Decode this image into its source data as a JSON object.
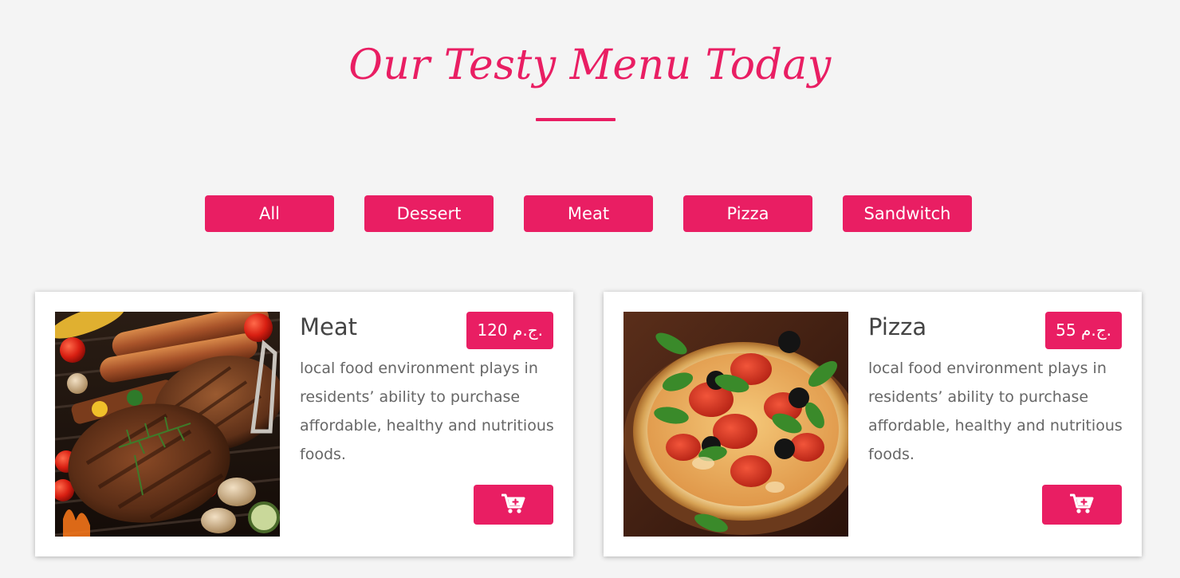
{
  "page": {
    "title": "Our Testy Menu Today"
  },
  "filters": [
    {
      "label": "All"
    },
    {
      "label": "Dessert"
    },
    {
      "label": "Meat"
    },
    {
      "label": "Pizza"
    },
    {
      "label": "Sandwitch"
    }
  ],
  "cards": [
    {
      "name": "Meat",
      "price": "120 ج.م.",
      "description": "local food environment plays in residents’ ability to purchase affordable, healthy and nutritious foods.",
      "image": "grilled-meat-photo",
      "cart_icon": "cart-plus-icon"
    },
    {
      "name": "Pizza",
      "price": "55 ج.م.",
      "description": "local food environment plays in residents’ ability to purchase affordable, healthy and nutritious foods.",
      "image": "pizza-photo",
      "cart_icon": "cart-plus-icon"
    }
  ],
  "colors": {
    "accent": "#e91e63",
    "background": "#f4f4f4",
    "card": "#ffffff",
    "text": "#444444"
  }
}
